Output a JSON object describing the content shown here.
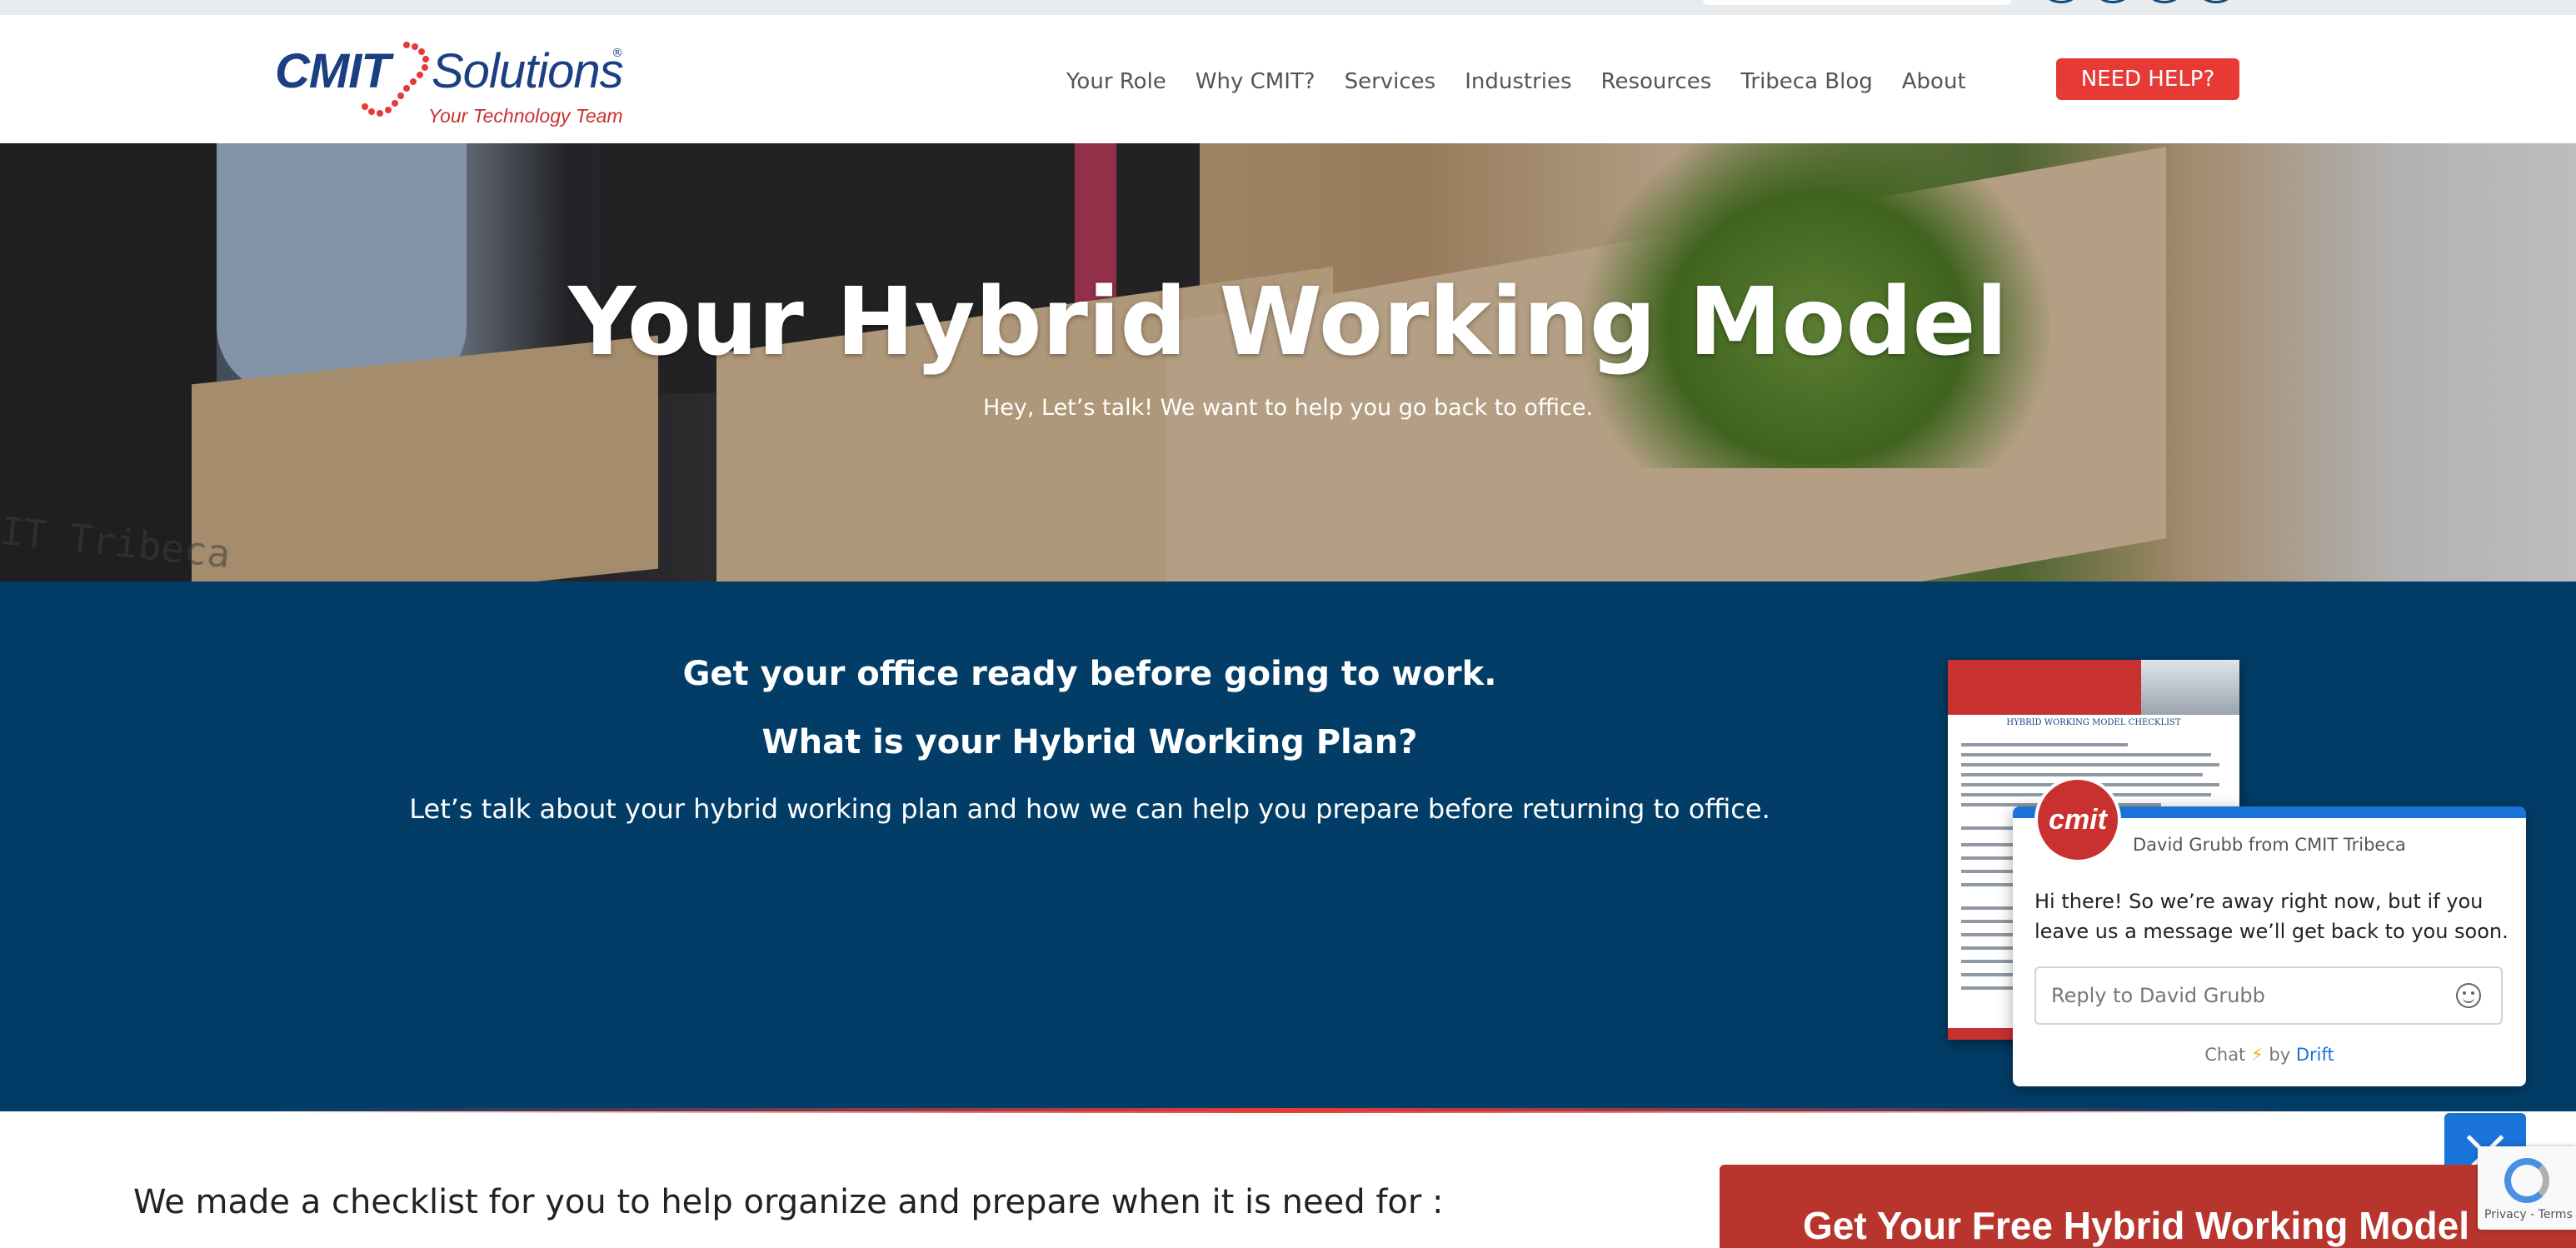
{
  "header": {
    "logo": {
      "wordmark": "CMIT",
      "wordmark2": "Solutions",
      "registered": "®",
      "tagline": "Your Technology Team"
    },
    "nav": [
      {
        "label": "Your Role"
      },
      {
        "label": "Why CMIT?"
      },
      {
        "label": "Services"
      },
      {
        "label": "Industries"
      },
      {
        "label": "Resources"
      },
      {
        "label": "Tribeca Blog"
      },
      {
        "label": "About"
      }
    ],
    "help_button": "NEED HELP?"
  },
  "hero": {
    "title": "Your Hybrid Working Model",
    "subtitle": "Hey, Let’s talk! We want to help you go back to office.",
    "watermark": "IT Tribeca"
  },
  "band": {
    "heading1": "Get your office ready before going to work.",
    "heading2": "What is your Hybrid Working Plan?",
    "paragraph": "Let’s talk about your hybrid working plan and how we can help you prepare before returning to office."
  },
  "document": {
    "title": "HYBRID WORKING MODEL CHECKLIST"
  },
  "chat": {
    "avatar_text": "cmit",
    "from": "David Grubb from CMIT Tribeca",
    "message": "Hi there! So we’re away right now, but if you leave us a message we’ll get back to you soon.",
    "reply_placeholder": "Reply to David Grubb",
    "credit_chat": "Chat",
    "credit_bolt": "⚡",
    "credit_by": "by",
    "credit_brand": "Drift"
  },
  "bottom": {
    "checklist_text": "We made a checklist for you to help organize and prepare when it is need for :",
    "cta_label": "Get Your Free Hybrid Working Model"
  },
  "recaptcha": {
    "text": "Privacy - Terms"
  },
  "colors": {
    "brand_blue": "#023d67",
    "accent_red": "#e83a35",
    "drift_blue": "#1a73d9"
  }
}
